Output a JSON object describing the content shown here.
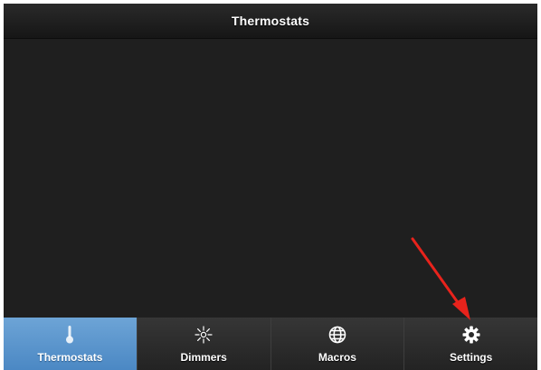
{
  "header": {
    "title": "Thermostats"
  },
  "tabs": [
    {
      "label": "Thermostats",
      "icon": "thermometer-icon",
      "active": true
    },
    {
      "label": "Dimmers",
      "icon": "dimmer-icon",
      "active": false
    },
    {
      "label": "Macros",
      "icon": "globe-icon",
      "active": false
    },
    {
      "label": "Settings",
      "icon": "gear-icon",
      "active": false
    }
  ],
  "colors": {
    "active_tab": "#5b97d0",
    "background": "#1f1f1f",
    "annotation_arrow": "#e8231c"
  }
}
